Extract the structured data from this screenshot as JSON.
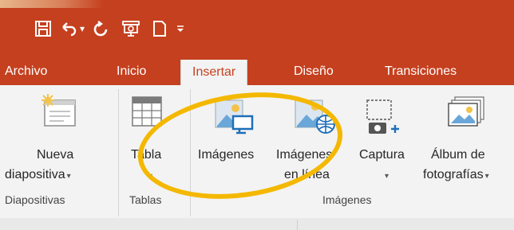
{
  "quick_access": {
    "save_icon": "save-icon",
    "undo_icon": "undo-icon",
    "redo_icon": "redo-icon",
    "present_icon": "present-from-start-icon",
    "new_icon": "new-document-icon",
    "customize_icon": "customize-qat-icon"
  },
  "tabs": [
    {
      "label": "Archivo"
    },
    {
      "label": "Inicio"
    },
    {
      "label": "Insertar"
    },
    {
      "label": "Diseño"
    },
    {
      "label": "Transiciones"
    }
  ],
  "active_tab": "Insertar",
  "ribbon": {
    "groups": [
      {
        "label": "Diapositivas",
        "buttons": [
          {
            "line1": "Nueva",
            "line2": "diapositiva",
            "icon": "new-slide-icon"
          }
        ]
      },
      {
        "label": "Tablas",
        "buttons": [
          {
            "line1": "Tabla",
            "line2": "",
            "icon": "table-icon"
          }
        ]
      },
      {
        "label": "Imágenes",
        "buttons": [
          {
            "line1": "Imágenes",
            "line2": "",
            "icon": "pictures-icon"
          },
          {
            "line1": "Imágenes",
            "line2": "en línea",
            "icon": "online-pictures-icon"
          },
          {
            "line1": "Captura",
            "line2": "",
            "icon": "screenshot-icon"
          },
          {
            "line1": "Álbum de",
            "line2": "fotografías",
            "icon": "photo-album-icon"
          }
        ]
      }
    ]
  },
  "colors": {
    "brand": "#c5401f",
    "ribbon_bg": "#f3f3f3",
    "highlight": "#f4b800"
  }
}
